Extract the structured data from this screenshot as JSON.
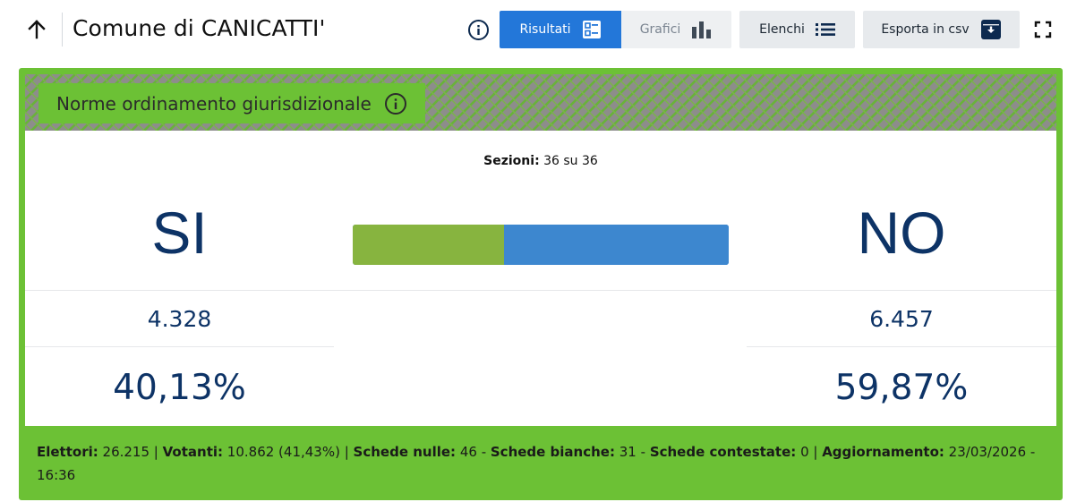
{
  "header": {
    "title": "Comune di CANICATTI'",
    "buttons": {
      "risultati": "Risultati",
      "grafici": "Grafici",
      "elenchi": "Elenchi",
      "esporta": "Esporta in csv"
    }
  },
  "card": {
    "topic": "Norme ordinamento giurisdizionale",
    "sections_label": "Sezioni:",
    "sections_value": "36 su 36",
    "si": {
      "label": "SI",
      "votes": "4.328",
      "percent": "40,13%",
      "share": 40.13
    },
    "no": {
      "label": "NO",
      "votes": "6.457",
      "percent": "59,87%",
      "share": 59.87
    }
  },
  "footer": {
    "elettori_label": "Elettori:",
    "elettori_value": "26.215",
    "votanti_label": "Votanti:",
    "votanti_value": "10.862 (41,43%)",
    "nulle_label": "Schede nulle:",
    "nulle_value": "46",
    "bianche_label": "Schede bianche:",
    "bianche_value": "31",
    "contestate_label": "Schede contestate:",
    "contestate_value": "0",
    "aggiornamento_label": "Aggiornamento:",
    "aggiornamento_value": "23/03/2026 - 16:36"
  },
  "colors": {
    "accent_blue": "#2377d9",
    "card_green": "#6cc135",
    "si_bar": "#87b43f",
    "no_bar": "#3d87cf",
    "value_text": "#0d3366"
  },
  "icons": [
    "arrow-up-icon",
    "info-icon",
    "list-detail-icon",
    "bar-chart-icon",
    "list-icon",
    "download-box-icon",
    "fullscreen-icon"
  ]
}
